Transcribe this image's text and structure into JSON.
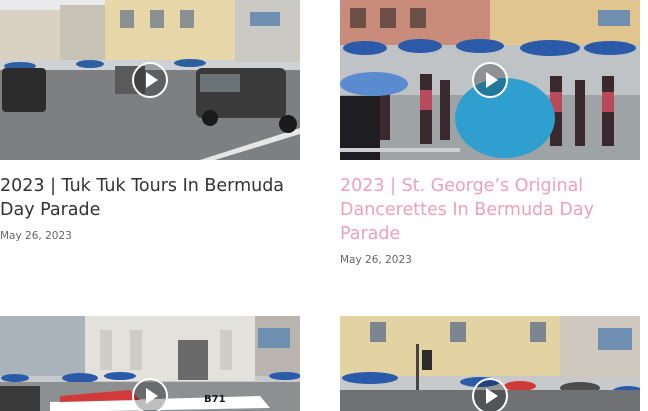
{
  "posts": [
    {
      "title": "2023 | Tuk Tuk Tours In Bermuda Day Parade",
      "date": "May 26, 2023",
      "thumbnail_icon": "play-icon"
    },
    {
      "title": "2023 | St. George’s Original Dancerettes In Bermuda Day Parade",
      "date": "May 26, 2023",
      "thumbnail_icon": "play-icon"
    },
    {
      "thumbnail_icon": "play-icon",
      "sign_text": "B71"
    },
    {
      "thumbnail_icon": "play-icon"
    }
  ],
  "colors": {
    "title_default": "#333333",
    "title_hover": "#ef9fbc",
    "date": "#666666"
  }
}
